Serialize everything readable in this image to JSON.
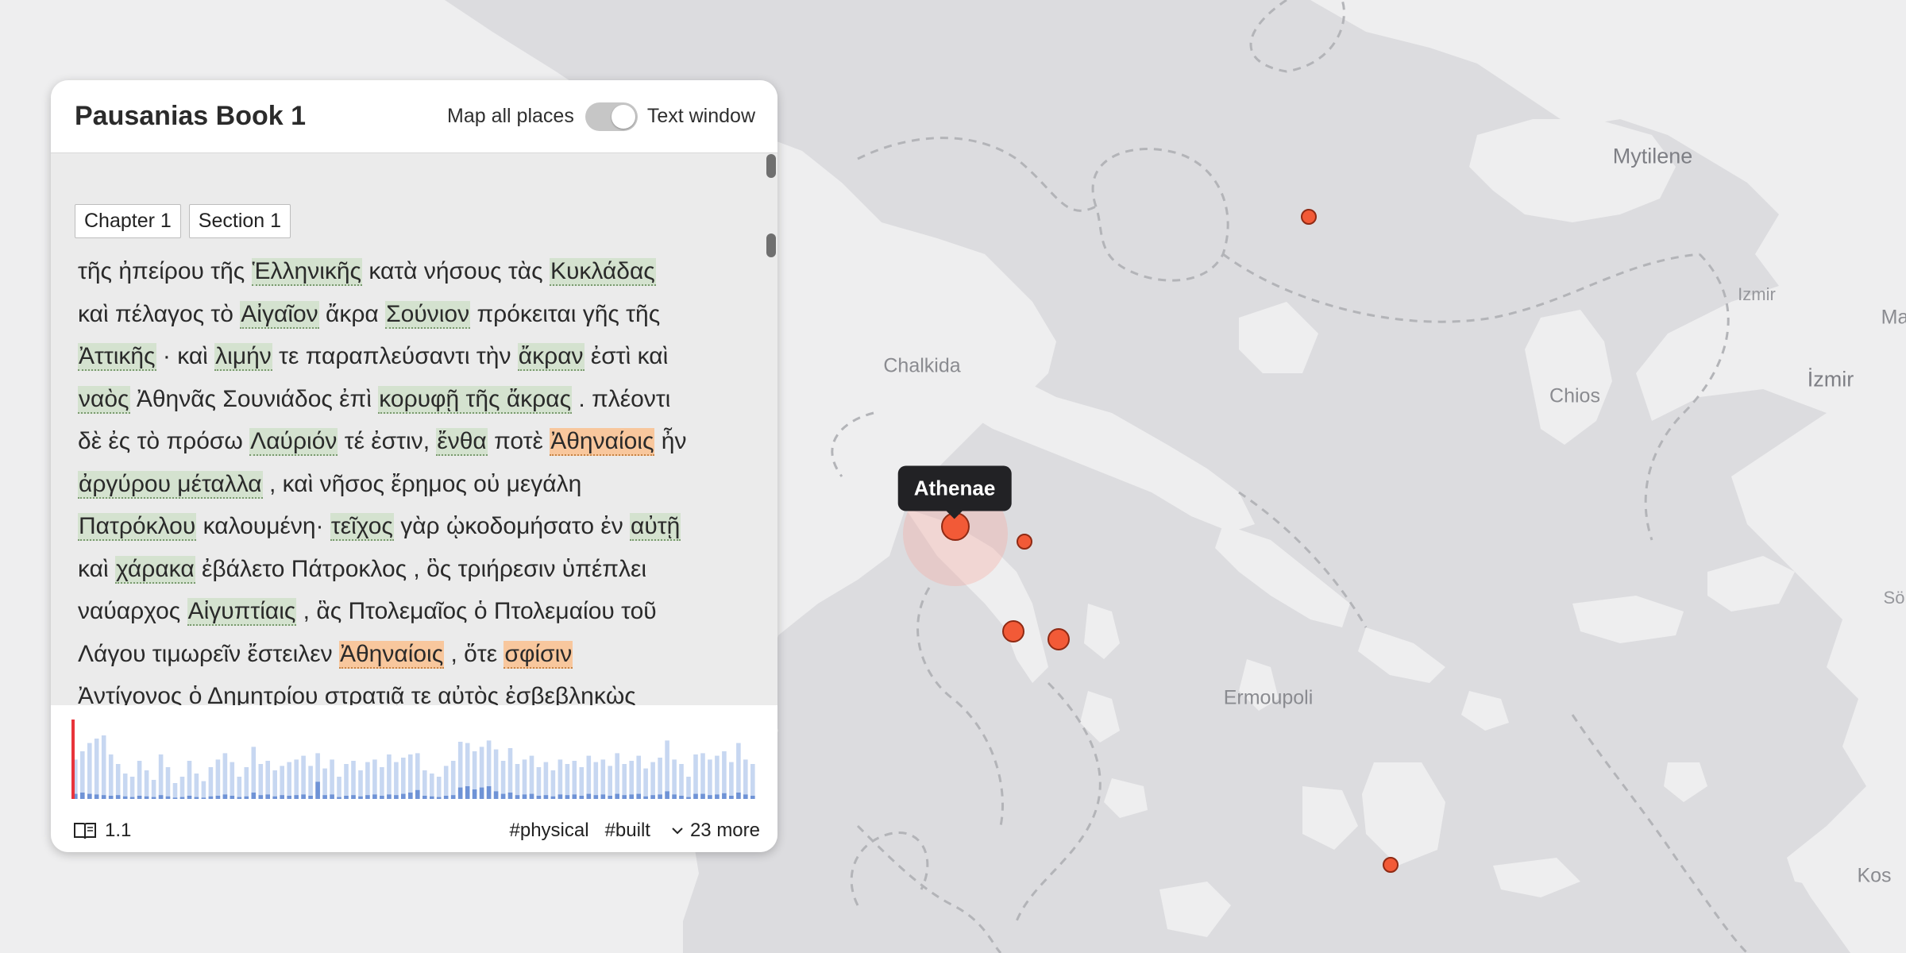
{
  "panel": {
    "title": "Pausanias Book 1",
    "toggle_left": "Map all places",
    "toggle_right": "Text window",
    "chips": [
      "Chapter 1",
      "Section 1"
    ],
    "text_lines": [
      [
        {
          "t": "τῆς ἠπείρου τῆς "
        },
        {
          "t": "Ἑλληνικῆς",
          "h": "g"
        },
        {
          "t": " κατὰ νήσους τὰς "
        },
        {
          "t": "Κυκλάδας",
          "h": "g"
        }
      ],
      [
        {
          "t": "καὶ πέλαγος τὸ "
        },
        {
          "t": "Αἰγαῖον",
          "h": "g"
        },
        {
          "t": " ἄκρα "
        },
        {
          "t": "Σούνιον",
          "h": "g"
        },
        {
          "t": " πρόκειται γῆς τῆς"
        }
      ],
      [
        {
          "t": "Ἀττικῆς",
          "h": "g"
        },
        {
          "t": " · καὶ "
        },
        {
          "t": "λιμήν",
          "h": "g"
        },
        {
          "t": " τε παραπλεύσαντι τὴν "
        },
        {
          "t": "ἄκραν",
          "h": "g"
        },
        {
          "t": " ἐστὶ καὶ"
        }
      ],
      [
        {
          "t": "ναὸς",
          "h": "g"
        },
        {
          "t": " Ἀθηνᾶς Σουνιάδος ἐπὶ "
        },
        {
          "t": "κορυφῇ τῆς ἄκρας",
          "h": "g"
        },
        {
          "t": " . πλέοντι"
        }
      ],
      [
        {
          "t": "δὲ ἐς τὸ πρόσω "
        },
        {
          "t": "Λαύριόν",
          "h": "g"
        },
        {
          "t": " τέ ἐστιν, "
        },
        {
          "t": "ἔνθα",
          "h": "g"
        },
        {
          "t": " ποτὲ "
        },
        {
          "t": "Ἀθηναίοις",
          "h": "o"
        },
        {
          "t": " ἦν"
        }
      ],
      [
        {
          "t": "ἀργύρου μέταλλα",
          "h": "g"
        },
        {
          "t": " , καὶ νῆσος ἔρημος οὐ μεγάλη"
        }
      ],
      [
        {
          "t": "Πατρόκλου",
          "h": "g"
        },
        {
          "t": " καλουμένη· "
        },
        {
          "t": "τεῖχος",
          "h": "g"
        },
        {
          "t": " γὰρ ᾠκοδομήσατο ἐν "
        },
        {
          "t": "αὐτῇ",
          "h": "g"
        }
      ],
      [
        {
          "t": "καὶ "
        },
        {
          "t": "χάρακα",
          "h": "g"
        },
        {
          "t": " ἐβάλετο Πάτροκλος , ὃς τριήρεσιν ὑπέπλει"
        }
      ],
      [
        {
          "t": "ναύαρχος "
        },
        {
          "t": "Αἰγυπτίαις",
          "h": "g"
        },
        {
          "t": " , ἃς Πτολεμαῖος ὁ Πτολεμαίου τοῦ"
        }
      ],
      [
        {
          "t": "Λάγου τιμωρεῖν ἔστειλεν "
        },
        {
          "t": "Ἀθηναίοις",
          "h": "o"
        },
        {
          "t": " , ὅτε "
        },
        {
          "t": "σφίσιν",
          "h": "o"
        }
      ],
      [
        {
          "t": "Ἀντίγονος ὁ Δημητρίου στρατιᾷ τε αὐτὸς ἐσβεβληκὼς"
        }
      ]
    ],
    "footer": {
      "ref": "1.1",
      "tags": [
        "#physical",
        "#built"
      ],
      "more": "23 more"
    },
    "timeline": {
      "current_index": 0,
      "accent": "#e8343a",
      "bar_color": "#c7d7f1",
      "dark_color": "#6f93d6",
      "heights": [
        0.62,
        0.75,
        0.88,
        0.95,
        1.0,
        0.7,
        0.55,
        0.4,
        0.35,
        0.6,
        0.45,
        0.3,
        0.7,
        0.5,
        0.25,
        0.35,
        0.6,
        0.4,
        0.28,
        0.5,
        0.62,
        0.72,
        0.58,
        0.35,
        0.5,
        0.82,
        0.55,
        0.6,
        0.45,
        0.52,
        0.58,
        0.62,
        0.68,
        0.52,
        0.72,
        0.48,
        0.62,
        0.35,
        0.55,
        0.6,
        0.45,
        0.58,
        0.62,
        0.5,
        0.7,
        0.58,
        0.65,
        0.7,
        0.72,
        0.45,
        0.4,
        0.35,
        0.52,
        0.6,
        0.9,
        0.88,
        0.75,
        0.82,
        0.92,
        0.78,
        0.6,
        0.8,
        0.55,
        0.62,
        0.68,
        0.5,
        0.58,
        0.45,
        0.62,
        0.55,
        0.6,
        0.5,
        0.68,
        0.58,
        0.62,
        0.52,
        0.72,
        0.55,
        0.6,
        0.68,
        0.48,
        0.58,
        0.65,
        0.92,
        0.62,
        0.55,
        0.35,
        0.7,
        0.72,
        0.62,
        0.68,
        0.75,
        0.58,
        0.88,
        0.62,
        0.55
      ],
      "dark": [
        0.08,
        0.1,
        0.08,
        0.07,
        0.06,
        0.05,
        0.06,
        0.04,
        0.03,
        0.05,
        0.04,
        0.03,
        0.06,
        0.04,
        0.02,
        0.03,
        0.05,
        0.03,
        0.02,
        0.04,
        0.05,
        0.07,
        0.05,
        0.03,
        0.04,
        0.1,
        0.06,
        0.07,
        0.04,
        0.06,
        0.05,
        0.06,
        0.07,
        0.05,
        0.27,
        0.06,
        0.07,
        0.03,
        0.05,
        0.06,
        0.04,
        0.06,
        0.07,
        0.05,
        0.07,
        0.06,
        0.08,
        0.1,
        0.14,
        0.05,
        0.04,
        0.03,
        0.05,
        0.06,
        0.18,
        0.2,
        0.15,
        0.18,
        0.2,
        0.12,
        0.08,
        0.1,
        0.06,
        0.07,
        0.08,
        0.05,
        0.06,
        0.04,
        0.07,
        0.06,
        0.07,
        0.05,
        0.08,
        0.06,
        0.07,
        0.05,
        0.08,
        0.06,
        0.07,
        0.08,
        0.04,
        0.06,
        0.07,
        0.12,
        0.07,
        0.05,
        0.03,
        0.08,
        0.08,
        0.06,
        0.07,
        0.09,
        0.05,
        0.1,
        0.07,
        0.05
      ]
    }
  },
  "map": {
    "tooltip": "Athenae",
    "labels": {
      "mytilene": "Mytilene",
      "izmir_small": "Izmir",
      "izmir": "İzmir",
      "chalkida": "Chalkida",
      "chios": "Chios",
      "ermoupoli": "Ermoupoli",
      "kos": "Kos",
      "ma": "Ma",
      "sol": "Sö"
    },
    "colors": {
      "sea": "#dcdcdf",
      "land": "#eeeeef",
      "marker": "#f25a37"
    }
  }
}
